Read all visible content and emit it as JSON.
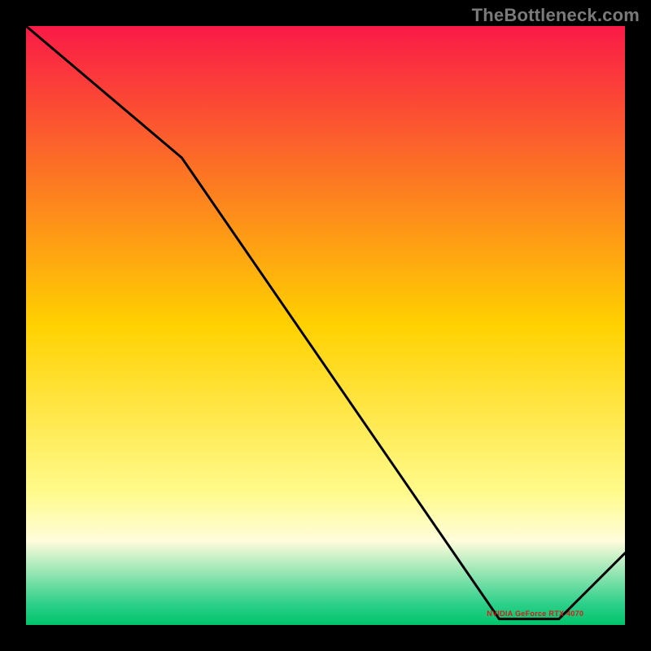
{
  "attribution": "TheBottleneck.com",
  "chart_data": {
    "type": "line",
    "title": "",
    "xlabel": "",
    "ylabel": "",
    "xlim": [
      0,
      1
    ],
    "ylim": [
      0,
      1
    ],
    "x": [
      0.0,
      0.26,
      0.79,
      0.89,
      1.0
    ],
    "y": [
      1.0,
      0.78,
      0.01,
      0.01,
      0.12
    ],
    "gradient_stops": [
      {
        "offset": 0.0,
        "color": "#fa1a47"
      },
      {
        "offset": 0.5,
        "color": "#ffd100"
      },
      {
        "offset": 0.78,
        "color": "#fffb8c"
      },
      {
        "offset": 0.86,
        "color": "#fffcdc"
      },
      {
        "offset": 0.965,
        "color": "#2dd08a"
      },
      {
        "offset": 1.0,
        "color": "#00c46b"
      }
    ],
    "annotation": {
      "label": "NVIDIA GeForce RTX 4070",
      "x": 0.84,
      "y": 0.018
    }
  }
}
